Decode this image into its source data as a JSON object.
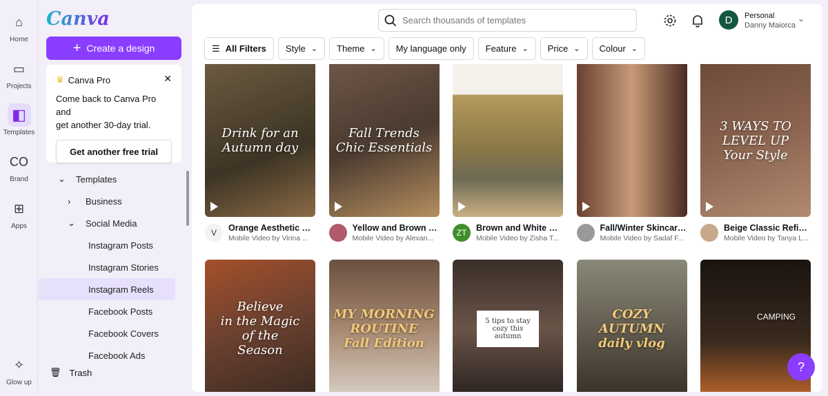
{
  "rail": [
    {
      "label": "Home",
      "icon": "home-icon"
    },
    {
      "label": "Projects",
      "icon": "folder-icon"
    },
    {
      "label": "Templates",
      "icon": "templates-icon"
    },
    {
      "label": "Brand",
      "icon": "brand-icon"
    },
    {
      "label": "Apps",
      "icon": "apps-icon"
    },
    {
      "label": "Glow up",
      "icon": "glow-up-icon"
    }
  ],
  "sidebar": {
    "logo": "Canva",
    "create_label": "Create a design",
    "pro": {
      "title": "Canva Pro",
      "text1": "Come back to Canva Pro and",
      "text2": "get another 30-day trial.",
      "button": "Get another free trial"
    },
    "tree": [
      {
        "label": "Templates",
        "chev": "⌄"
      },
      {
        "label": "Business",
        "chev": "›"
      },
      {
        "label": "Social Media",
        "chev": "⌄"
      },
      {
        "label": "Instagram Posts"
      },
      {
        "label": "Instagram Stories"
      },
      {
        "label": "Instagram Reels"
      },
      {
        "label": "Facebook Posts"
      },
      {
        "label": "Facebook Covers"
      },
      {
        "label": "Facebook Ads"
      }
    ],
    "trash": "Trash"
  },
  "header": {
    "search_placeholder": "Search thousands of templates",
    "account": {
      "initial": "D",
      "team": "Personal",
      "name": "Danny Maiorca"
    }
  },
  "filters": [
    "All Filters",
    "Style",
    "Theme",
    "My language only",
    "Feature",
    "Price",
    "Colour"
  ],
  "row1": [
    {
      "title": "Orange Aesthetic C...",
      "sub": "Mobile Video by Virina ...",
      "av": "V",
      "avcolor": "#f2f2f2",
      "thumb": "Drink for an\nAutumn day",
      "bg": "linear-gradient(160deg,#6b5a40,#3d3425 60%,#8a6a45)"
    },
    {
      "title": "Yellow and Brown Vi...",
      "sub": "Mobile Video by Alexan...",
      "av": "",
      "avcolor": "#b05a6a",
      "thumb": "Fall Trends\nChic Essentials",
      "bg": "linear-gradient(160deg,#6e5646,#4a3a30 50%,#b58e5e)"
    },
    {
      "title": "Brown and White Mi...",
      "sub": "Mobile Video by Zisha T...",
      "av": "ZT",
      "avcolor": "#3f8f2a",
      "thumb": "",
      "bg": "linear-gradient(180deg,#f4f1ea 0 20%,#b59a5c 20%,#8a7848 55%,#6d6a55 75%,#c9b083)"
    },
    {
      "title": "Fall/Winter Skincare...",
      "sub": "Mobile Video by Sadaf F...",
      "av": "",
      "avcolor": "#999",
      "thumb": "",
      "bg": "linear-gradient(90deg,#6b4030,#c79b78 50%,#4a2a22)"
    },
    {
      "title": "Beige Classic Refine...",
      "sub": "Mobile Video by Tanya L...",
      "av": "",
      "avcolor": "#c8a88a",
      "thumb": "3 WAYS TO LEVEL UP\nYour Style",
      "bg": "linear-gradient(160deg,#6d4a3a,#8b6450 50%,#b08a70)"
    }
  ],
  "row2": [
    {
      "thumb": "Believe\nin the Magic\nof the\nSeason",
      "bg": "linear-gradient(160deg,#a4502a,#6a4030 50%,#3a2a20)"
    },
    {
      "thumb": "MY MORNING\nROUTINE\nFall Edition",
      "bg": "linear-gradient(180deg,#6a5040,#a68870 50%,#d8cfc4)"
    },
    {
      "thumb": "5 tips to stay cozy this autumn",
      "bg": "linear-gradient(180deg,#3a2e28,#6a5448 50%,#2a2220)"
    },
    {
      "thumb": "COZY AUTUMN\ndaily vlog",
      "bg": "linear-gradient(180deg,#8a8878,#5a5448 60%,#3a3028)"
    },
    {
      "thumb": "CAMPING",
      "bg": "linear-gradient(180deg,#1a1410,#3a2a1e 60%,#b8642a)"
    }
  ],
  "help": "?"
}
